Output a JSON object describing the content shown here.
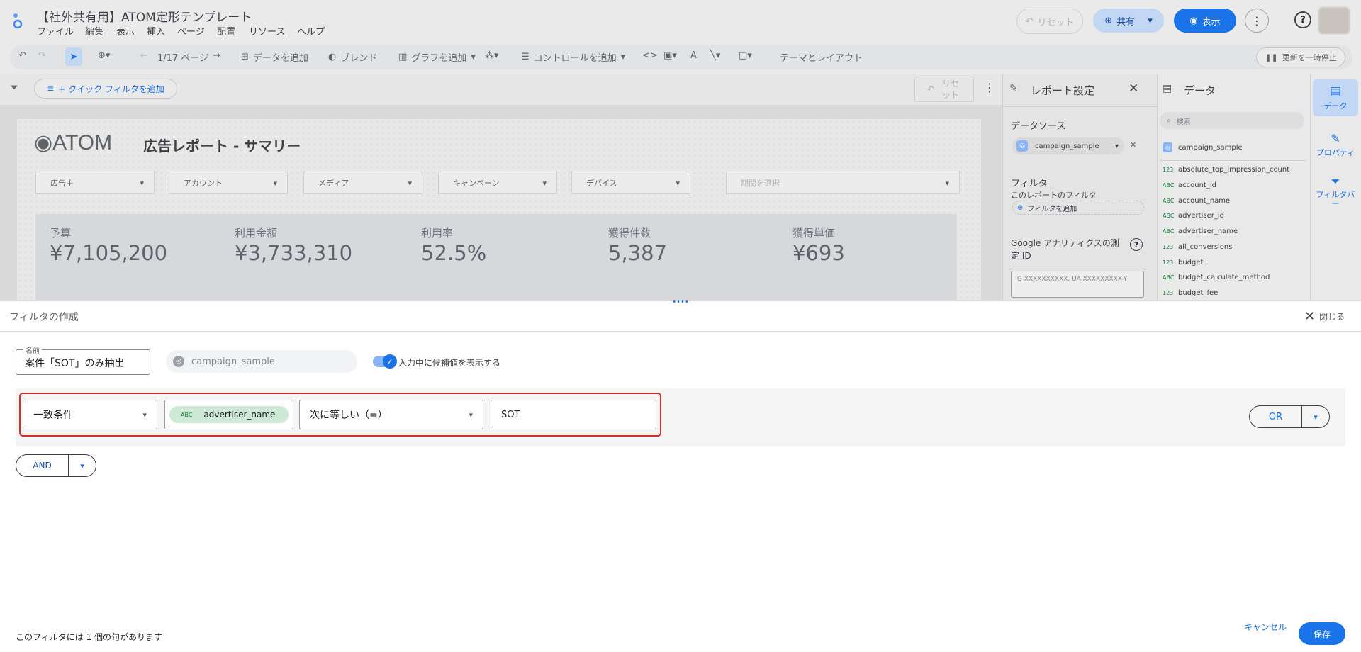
{
  "header": {
    "title": "【社外共有用】ATOM定形テンプレート",
    "menu": [
      "ファイル",
      "編集",
      "表示",
      "挿入",
      "ページ",
      "配置",
      "リソース",
      "ヘルプ"
    ],
    "reset_label": "リセット",
    "share_label": "共有",
    "view_label": "表示"
  },
  "toolbar": {
    "page_indicator": "1/17 ページ",
    "add_data": "データを追加",
    "blend": "ブレンド",
    "add_chart": "グラフを追加",
    "add_control": "コントロールを追加",
    "theme_layout": "テーマとレイアウト",
    "pause_update": "更新を一時停止"
  },
  "filterbar": {
    "quick_filter": "+ クイック フィルタを追加",
    "reset": "リセット"
  },
  "canvas": {
    "logo": "◉ATOM",
    "report_title": "広告レポート - サマリー",
    "dropdowns": [
      "広告主",
      "アカウント",
      "メディア",
      "キャンペーン",
      "デバイス"
    ],
    "date_placeholder": "期間を選択",
    "kpis": [
      {
        "label": "予算",
        "value": "¥7,105,200"
      },
      {
        "label": "利用金額",
        "value": "¥3,733,310"
      },
      {
        "label": "利用率",
        "value": "52.5%"
      },
      {
        "label": "獲得件数",
        "value": "5,387"
      },
      {
        "label": "獲得単価",
        "value": "¥693"
      }
    ]
  },
  "report_settings": {
    "title": "レポート設定",
    "datasource_heading": "データソース",
    "datasource": "campaign_sample",
    "filter_heading": "フィルタ",
    "filter_sub": "このレポートのフィルタ",
    "add_filter": "フィルタを追加",
    "ga_heading": "Google アナリティクスの測定 ID",
    "ga_placeholder": "G-XXXXXXXXXX, UA-XXXXXXXXX-Y"
  },
  "data_panel": {
    "title": "データ",
    "search_placeholder": "検索",
    "datasource": "campaign_sample",
    "fields": [
      {
        "type": "123",
        "name": "absolute_top_impression_count"
      },
      {
        "type": "ABC",
        "name": "account_id"
      },
      {
        "type": "ABC",
        "name": "account_name"
      },
      {
        "type": "ABC",
        "name": "advertiser_id"
      },
      {
        "type": "ABC",
        "name": "advertiser_name"
      },
      {
        "type": "123",
        "name": "all_conversions"
      },
      {
        "type": "123",
        "name": "budget"
      },
      {
        "type": "ABC",
        "name": "budget_calculate_method"
      },
      {
        "type": "123",
        "name": "budget_fee"
      }
    ]
  },
  "rail": {
    "data": "データ",
    "properties": "プロパティ",
    "filter_bar": "フィルタバー"
  },
  "filter_editor": {
    "heading": "フィルタの作成",
    "close": "閉じる",
    "name_label": "名前",
    "name_value": "案件「SOT」のみ抽出",
    "datasource": "campaign_sample",
    "suggest_toggle": "入力中に候補値を表示する",
    "condition_type": "一致条件",
    "field_type": "ABC",
    "field": "advertiser_name",
    "operator": "次に等しい（=）",
    "value": "SOT",
    "or_label": "OR",
    "and_label": "AND",
    "clause_count": "このフィルタには 1 個の句があります",
    "cancel": "キャンセル",
    "save": "保存"
  },
  "colors": {
    "accent": "#1a73e8",
    "highlight_border": "#d93025",
    "chip_green": "#ceead6"
  }
}
